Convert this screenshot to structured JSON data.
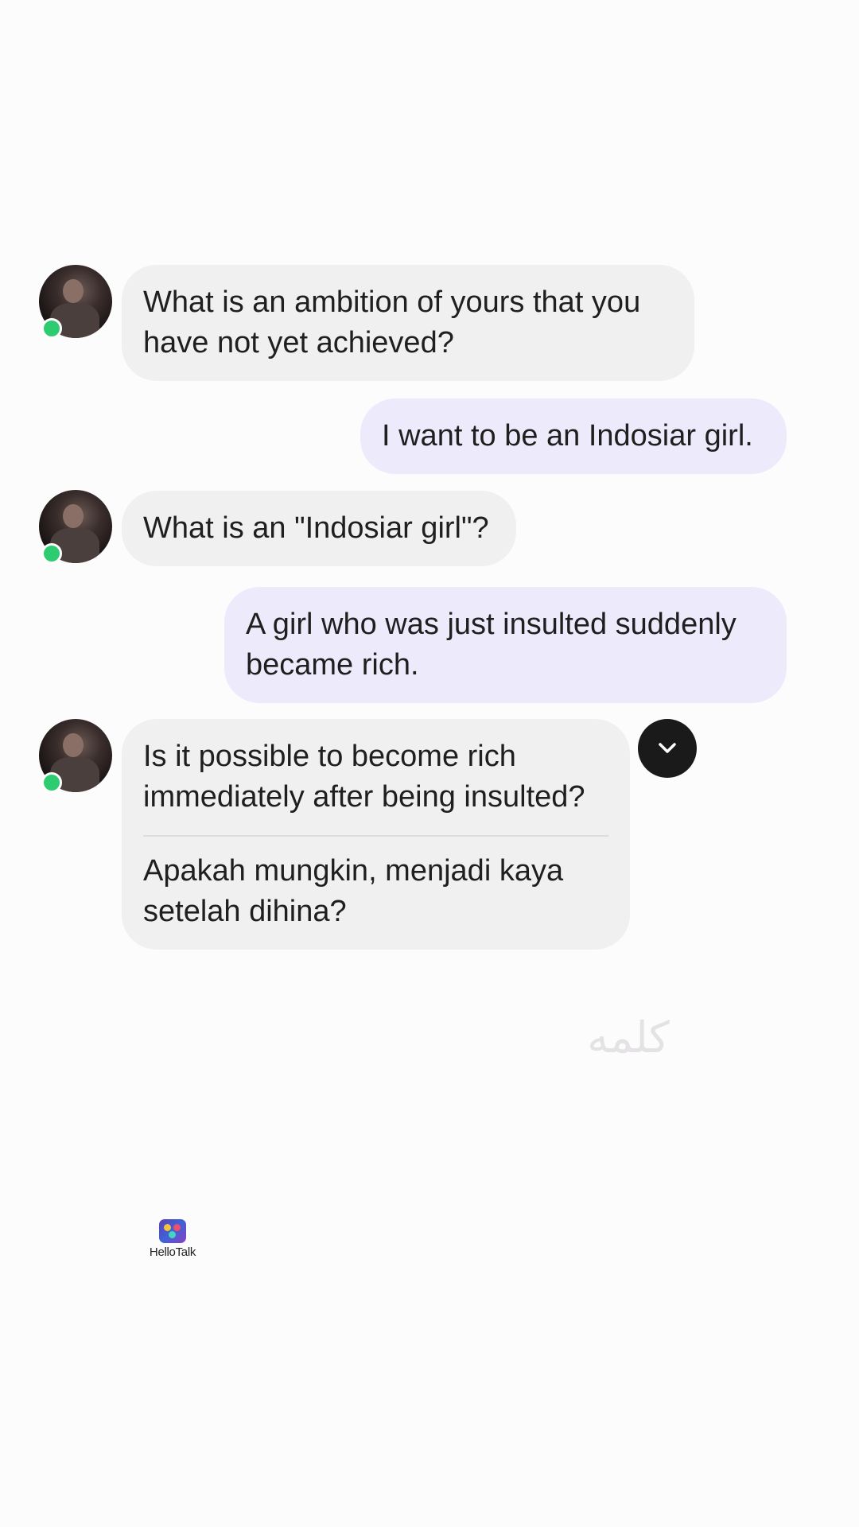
{
  "conversation": {
    "messages": [
      {
        "sender": "partner",
        "text": "What is an ambition of yours that you have not yet achieved?"
      },
      {
        "sender": "me",
        "text": "I want to be an Indosiar girl."
      },
      {
        "sender": "partner",
        "text": "What is an \"Indosiar girl\"?"
      },
      {
        "sender": "me",
        "text": "A girl who was just insulted suddenly became rich."
      },
      {
        "sender": "partner",
        "text": "Is it possible to become rich immediately after being insulted?",
        "translation": "Apakah mungkin, menjadi kaya setelah dihina?"
      }
    ]
  },
  "icons": {
    "avatar": "partner-avatar",
    "online": "online-status-dot",
    "scroll": "chevron-down-icon"
  },
  "watermark": {
    "text": "كلمه"
  },
  "branding": {
    "logo_label": "HelloTalk"
  },
  "colors": {
    "incoming_bubble": "#f1f0f1",
    "outgoing_bubble": "#edeafc",
    "online": "#2ecc71",
    "scroll_button": "#1a1a1a"
  }
}
